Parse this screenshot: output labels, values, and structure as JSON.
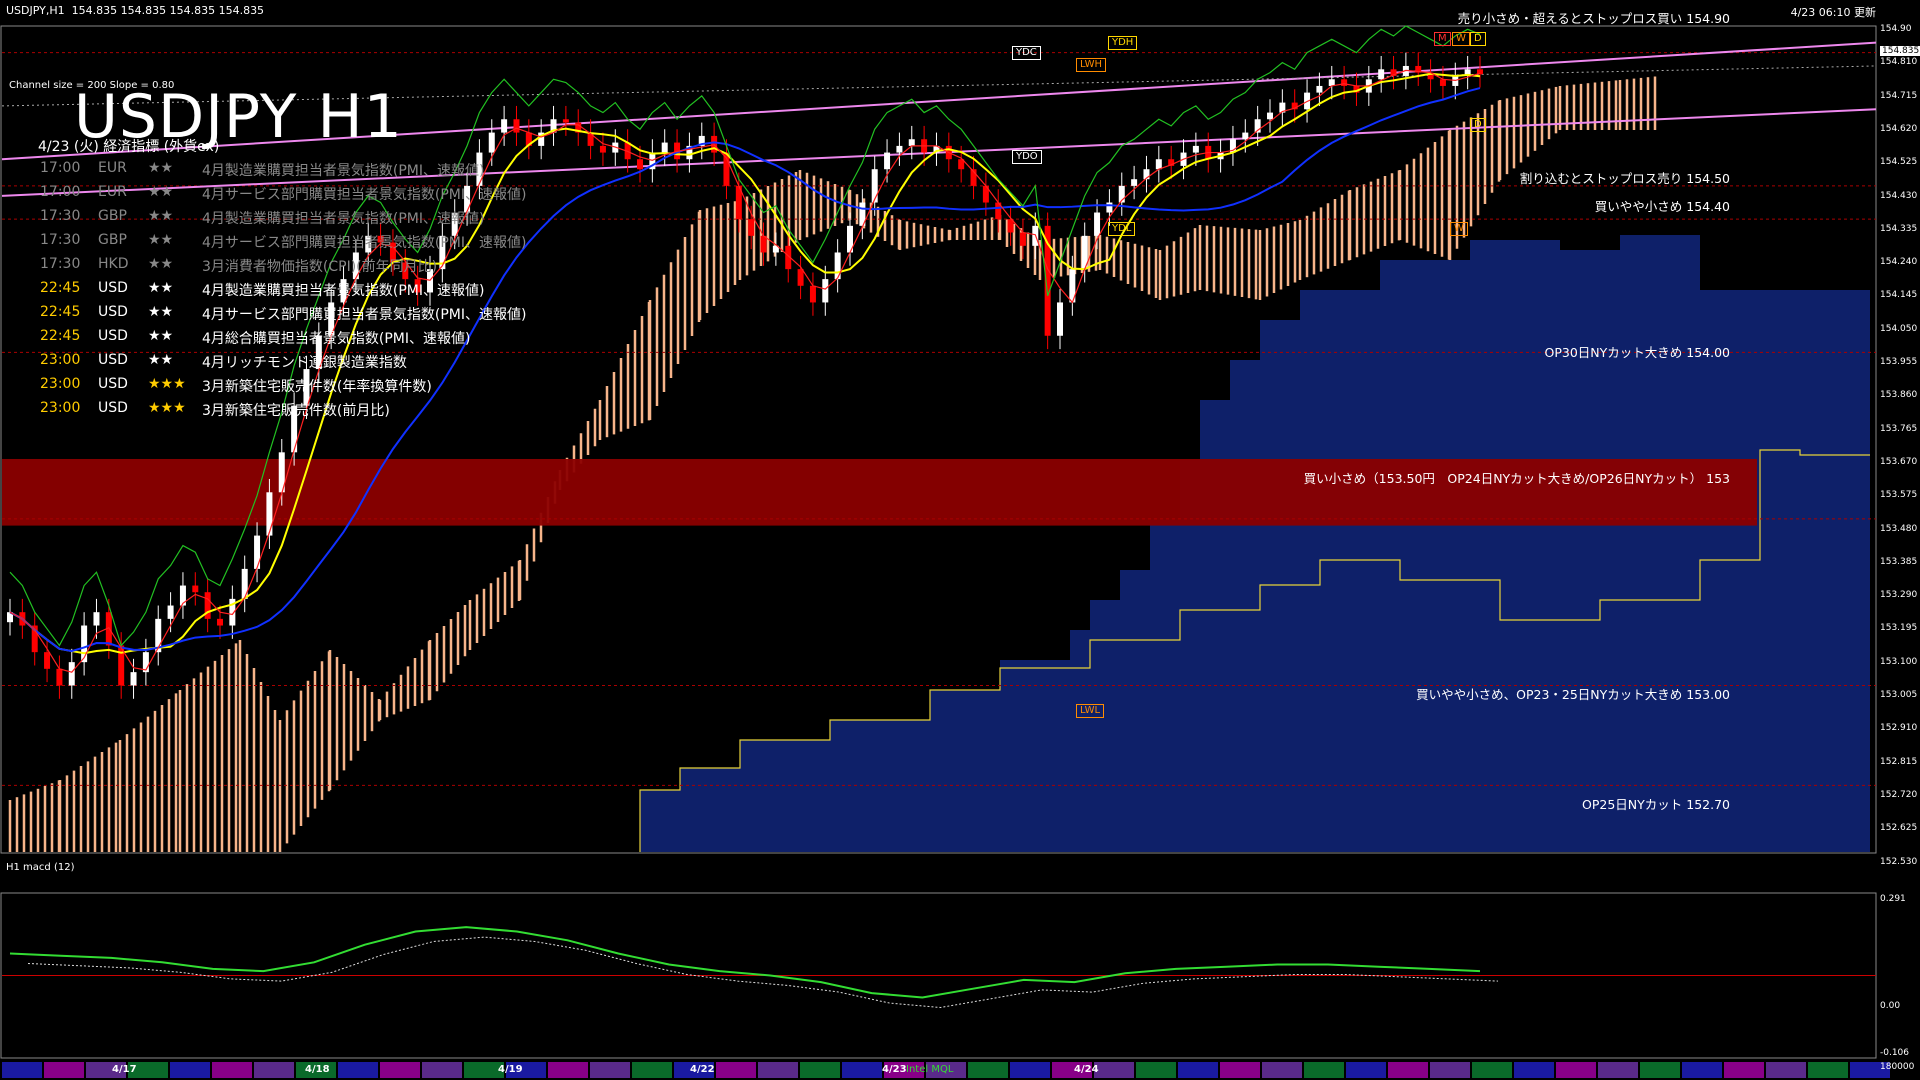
{
  "header": {
    "symbol_line": "USDJPY,H1  154.835 154.835 154.835 154.835",
    "updated": "4/23 06:10 更新"
  },
  "title": "USDJPY H1",
  "subtitle": "4/23 (火) 経済指標 (外貨ex)",
  "channel_info": "Channel size = 200 Slope = 0.80",
  "events": [
    {
      "time": "17:00",
      "cur": "EUR",
      "stars": "★★",
      "name": "4月製造業購買担当者景気指数(PMI、速報値)",
      "past": true
    },
    {
      "time": "17:00",
      "cur": "EUR",
      "stars": "★★",
      "name": "4月サービス部門購買担当者景気指数(PMI、速報値)",
      "past": true
    },
    {
      "time": "17:30",
      "cur": "GBP",
      "stars": "★★",
      "name": "4月製造業購買担当者景気指数(PMI、速報値)",
      "past": true
    },
    {
      "time": "17:30",
      "cur": "GBP",
      "stars": "★★",
      "name": "4月サービス部門購買担当者景気指数(PMI、速報値)",
      "past": true
    },
    {
      "time": "17:30",
      "cur": "HKD",
      "stars": "★★",
      "name": "3月消費者物価指数(CPI)(前年同月比)",
      "past": true
    },
    {
      "time": "22:45",
      "cur": "USD",
      "stars": "★★",
      "name": "4月製造業購買担当者景気指数(PMI、速報値)",
      "past": false
    },
    {
      "time": "22:45",
      "cur": "USD",
      "stars": "★★",
      "name": "4月サービス部門購買担当者景気指数(PMI、速報値)",
      "past": false
    },
    {
      "time": "22:45",
      "cur": "USD",
      "stars": "★★",
      "name": "4月総合購買担当者景気指数(PMI、速報値)",
      "past": false
    },
    {
      "time": "23:00",
      "cur": "USD",
      "stars": "★★",
      "name": "4月リッチモンド連銀製造業指数",
      "past": false
    },
    {
      "time": "23:00",
      "cur": "USD",
      "stars": "★★★",
      "name": "3月新築住宅販売件数(年率換算件数)",
      "past": false
    },
    {
      "time": "23:00",
      "cur": "USD",
      "stars": "★★★",
      "name": "3月新築住宅販売件数(前月比)",
      "past": false
    }
  ],
  "levels": [
    {
      "price": 154.9,
      "text": "売り小さめ・超えるとストップロス買い 154.90"
    },
    {
      "price": 154.5,
      "text": "割り込むとストップロス売り 154.50"
    },
    {
      "price": 154.4,
      "text": "買いやや小さめ 154.40"
    },
    {
      "price": 154.0,
      "text": "OP30日NYカット大きめ 154.00"
    },
    {
      "price": 153.5,
      "text": "買い小さめ（153.50円　OP24日NYカット大きめ/OP26日NYカット） 153"
    },
    {
      "price": 153.0,
      "text": "買いやや小さめ、OP23・25日NYカット大きめ 153.00"
    },
    {
      "price": 152.7,
      "text": "OP25日NYカット 152.70"
    }
  ],
  "tags": [
    {
      "text": "YDC",
      "color": "#ffffff"
    },
    {
      "text": "YDH",
      "color": "#ffd700"
    },
    {
      "text": "LWH",
      "color": "#ff8c00"
    },
    {
      "text": "YDO",
      "color": "#ffffff"
    },
    {
      "text": "YDL",
      "color": "#ffd700"
    },
    {
      "text": "LWL",
      "color": "#ff8c00"
    },
    {
      "text": "M",
      "color": "#ff3030"
    },
    {
      "text": "W",
      "color": "#ff8c00"
    },
    {
      "text": "D",
      "color": "#ffd700"
    },
    {
      "text": "D",
      "color": "#ffd700"
    },
    {
      "text": "W",
      "color": "#ff8c00"
    }
  ],
  "price_axis": [
    "154.90",
    "154.810",
    "154.715",
    "154.620",
    "154.525",
    "154.430",
    "154.335",
    "154.240",
    "154.145",
    "154.050",
    "153.955",
    "153.860",
    "153.765",
    "153.670",
    "153.575",
    "153.480",
    "153.385",
    "153.290",
    "153.195",
    "153.100",
    "153.005",
    "152.910",
    "152.815",
    "152.720",
    "152.625",
    "152.530"
  ],
  "current_price": "154.835",
  "macd_label": "H1  macd (12)",
  "macd_axis": [
    "0.291",
    "0.00",
    "-0.106",
    "180000"
  ],
  "dates": [
    "4/17",
    "4/18",
    "4/19",
    "4/22",
    "4/23",
    "4/24"
  ],
  "date_bar_text": "Intel MQL",
  "colors": {
    "bull": "#ffffff",
    "bear": "#ff0000",
    "ma_fast": "#ffff00",
    "ma_slow": "#1030ff",
    "cloud_up": "#f6b48a",
    "cloud_down": "#1a3bbf",
    "channel": "#ee88ee",
    "zone": "#8b0000"
  },
  "chart_data": {
    "type": "candlestick",
    "title": "USDJPY H1",
    "ylim": [
      152.5,
      154.98
    ],
    "close": [
      153.22,
      153.18,
      153.1,
      153.05,
      153.0,
      153.07,
      153.18,
      153.22,
      153.12,
      153.0,
      153.04,
      153.1,
      153.2,
      153.24,
      153.3,
      153.28,
      153.2,
      153.18,
      153.26,
      153.35,
      153.45,
      153.58,
      153.7,
      153.84,
      153.95,
      154.05,
      154.15,
      154.22,
      154.3,
      154.35,
      154.33,
      154.27,
      154.22,
      154.18,
      154.25,
      154.35,
      154.42,
      154.5,
      154.6,
      154.66,
      154.7,
      154.66,
      154.62,
      154.66,
      154.7,
      154.69,
      154.66,
      154.62,
      154.6,
      154.63,
      154.58,
      154.55,
      154.6,
      154.63,
      154.58,
      154.62,
      154.65,
      154.6,
      154.5,
      154.4,
      154.35,
      154.3,
      154.32,
      154.25,
      154.2,
      154.15,
      154.22,
      154.3,
      154.38,
      154.45,
      154.55,
      154.6,
      154.62,
      154.64,
      154.6,
      154.62,
      154.58,
      154.55,
      154.5,
      154.45,
      154.4,
      154.36,
      154.32,
      154.38,
      154.05,
      154.15,
      154.25,
      154.35,
      154.42,
      154.45,
      154.5,
      154.52,
      154.55,
      154.58,
      154.56,
      154.6,
      154.62,
      154.58,
      154.6,
      154.64,
      154.66,
      154.7,
      154.72,
      154.75,
      154.73,
      154.78,
      154.8,
      154.82,
      154.8,
      154.78,
      154.82,
      154.85,
      154.83,
      154.86,
      154.84,
      154.82,
      154.8,
      154.83,
      154.85,
      154.835
    ],
    "macd": [
      0.1,
      0.09,
      0.08,
      0.06,
      0.03,
      0.02,
      0.06,
      0.14,
      0.2,
      0.22,
      0.2,
      0.16,
      0.1,
      0.05,
      0.02,
      0.0,
      -0.03,
      -0.08,
      -0.1,
      -0.06,
      -0.02,
      -0.03,
      0.01,
      0.03,
      0.04,
      0.05,
      0.05,
      0.04,
      0.03,
      0.02
    ]
  }
}
